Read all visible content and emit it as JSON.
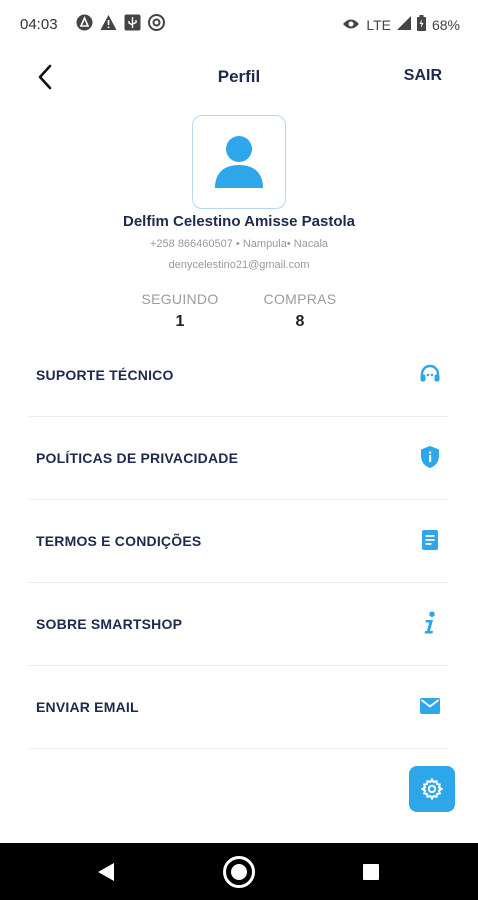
{
  "status": {
    "time": "04:03",
    "network": "LTE",
    "battery": "68%"
  },
  "header": {
    "title": "Perfil",
    "logout_label": "SAIR"
  },
  "profile": {
    "name": "Delfim Celestino Amisse Pastola",
    "meta": "+258 866460507 • Nampula• Nacala",
    "email": "denycelestino21@gmail.com"
  },
  "stats": [
    {
      "label": "SEGUINDO",
      "value": "1"
    },
    {
      "label": "COMPRAS",
      "value": "8"
    }
  ],
  "menu": [
    {
      "label": "SUPORTE TÉCNICO",
      "icon": "headset-icon"
    },
    {
      "label": "POLÍTICAS DE PRIVACIDADE",
      "icon": "shield-info-icon"
    },
    {
      "label": "TERMOS E CONDIÇÕES",
      "icon": "document-icon"
    },
    {
      "label": "SOBRE SMARTSHOP",
      "icon": "info-icon"
    },
    {
      "label": "ENVIAR EMAIL",
      "icon": "mail-icon"
    }
  ],
  "colors": {
    "accent": "#2da6ea",
    "text_dark": "#1d2a4d"
  }
}
